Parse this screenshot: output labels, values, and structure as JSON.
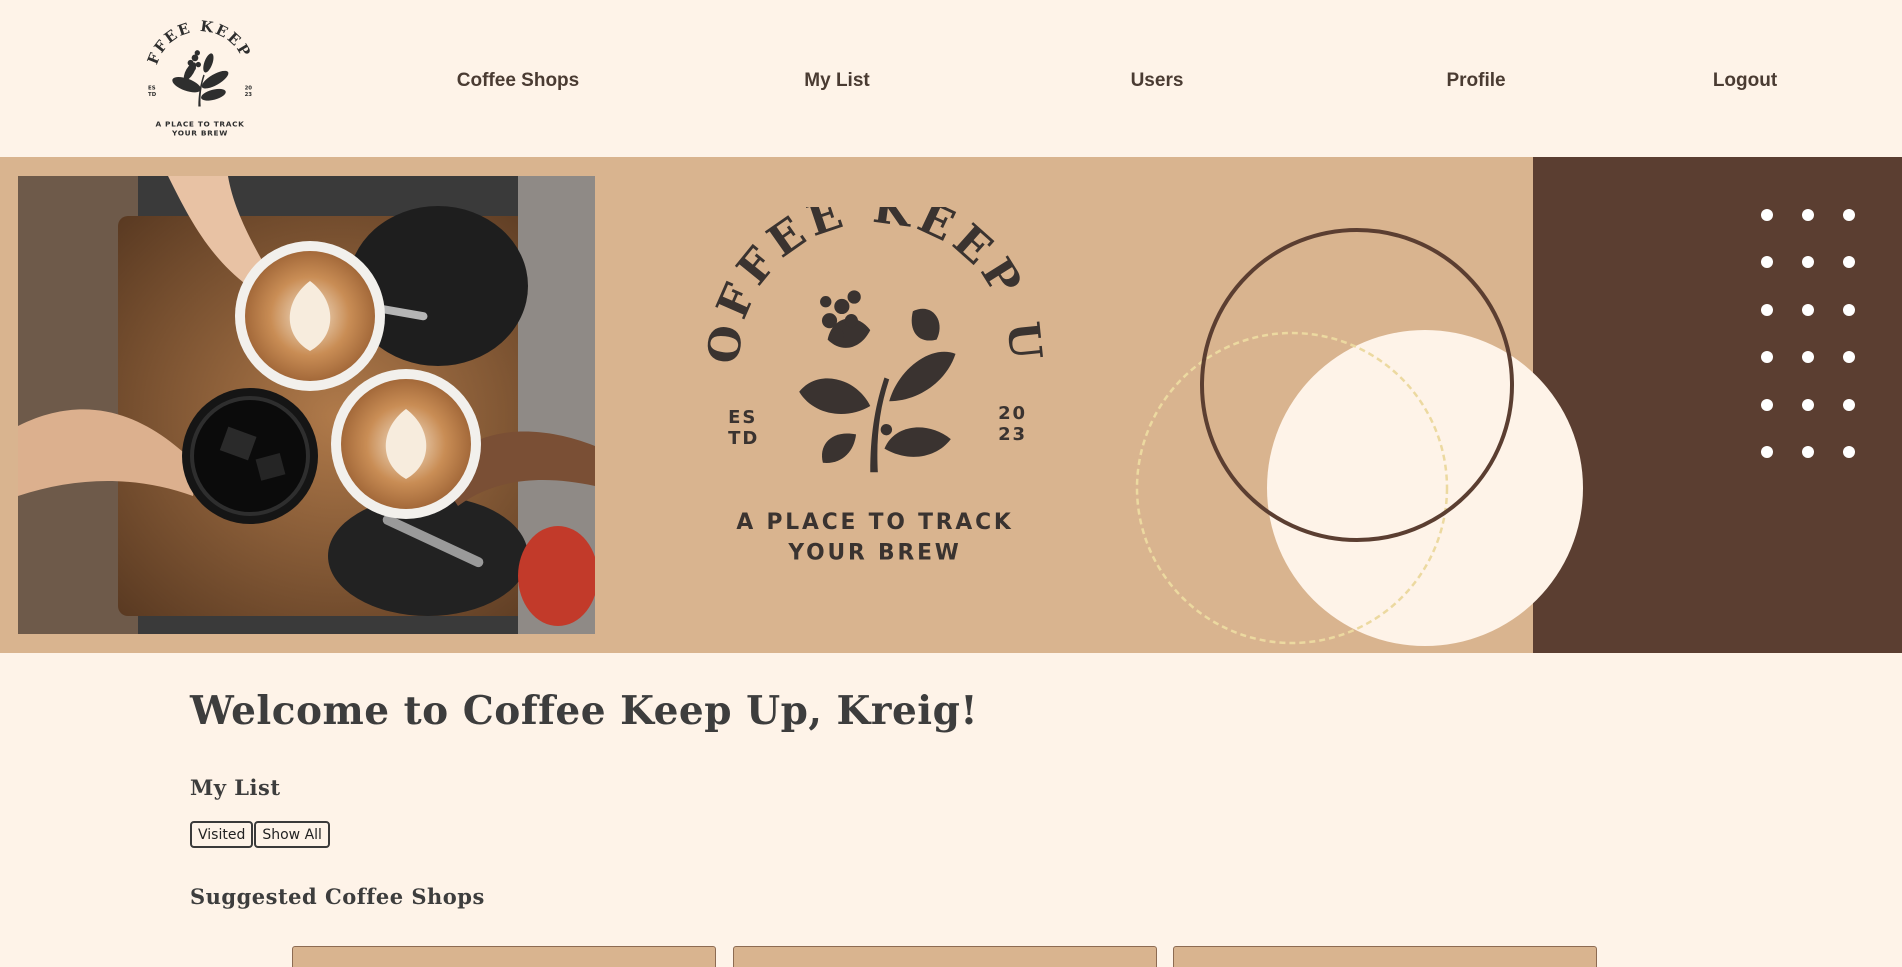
{
  "brand": {
    "arc_text": "COFFEE KEEP UP",
    "est_left": [
      "ES",
      "TD"
    ],
    "est_right": [
      "20",
      "23"
    ],
    "tagline_line1": "A PLACE TO TRACK",
    "tagline_line2": "YOUR BREW"
  },
  "nav": {
    "items": [
      {
        "label": "Coffee Shops"
      },
      {
        "label": "My List"
      },
      {
        "label": "Users"
      },
      {
        "label": "Profile"
      },
      {
        "label": "Logout"
      }
    ]
  },
  "hero": {
    "colors": {
      "tan": "#d9b48f",
      "brown": "#5b3e31",
      "cream": "#fef3e8",
      "dashed": "#ecd9a0"
    }
  },
  "main": {
    "welcome": "Welcome to Coffee Keep Up, Kreig!",
    "my_list_title": "My List",
    "filter_buttons": {
      "visited": "Visited",
      "show_all": "Show All"
    },
    "suggested_title": "Suggested Coffee Shops"
  }
}
